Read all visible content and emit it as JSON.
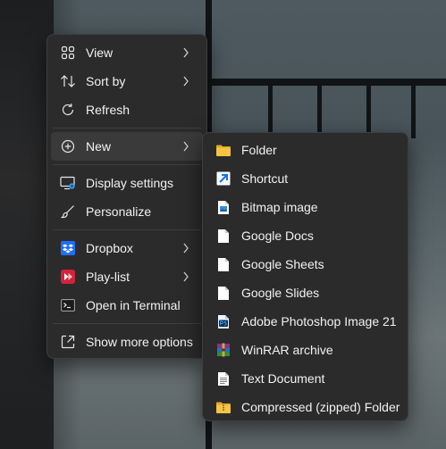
{
  "context_menu": {
    "items": [
      {
        "label": "View",
        "icon": "grid-icon",
        "has_submenu": true
      },
      {
        "label": "Sort by",
        "icon": "sort-icon",
        "has_submenu": true
      },
      {
        "label": "Refresh",
        "icon": "refresh-icon",
        "has_submenu": false
      },
      {
        "label": "New",
        "icon": "plus-circle-icon",
        "has_submenu": true,
        "highlighted": true
      },
      {
        "label": "Display settings",
        "icon": "display-settings-icon",
        "has_submenu": false
      },
      {
        "label": "Personalize",
        "icon": "brush-icon",
        "has_submenu": false
      },
      {
        "label": "Dropbox",
        "icon": "dropbox-icon",
        "has_submenu": true
      },
      {
        "label": "Play-list",
        "icon": "playlist-icon",
        "has_submenu": true
      },
      {
        "label": "Open in Terminal",
        "icon": "terminal-icon",
        "has_submenu": false
      },
      {
        "label": "Show more options",
        "icon": "show-more-icon",
        "has_submenu": false
      }
    ]
  },
  "new_submenu": {
    "items": [
      {
        "label": "Folder",
        "icon": "folder-icon"
      },
      {
        "label": "Shortcut",
        "icon": "shortcut-icon"
      },
      {
        "label": "Bitmap image",
        "icon": "bitmap-file-icon"
      },
      {
        "label": "Google Docs",
        "icon": "file-icon"
      },
      {
        "label": "Google Sheets",
        "icon": "file-icon"
      },
      {
        "label": "Google Slides",
        "icon": "file-icon"
      },
      {
        "label": "Adobe Photoshop Image 21",
        "icon": "photoshop-icon"
      },
      {
        "label": "WinRAR archive",
        "icon": "winrar-icon"
      },
      {
        "label": "Text Document",
        "icon": "text-document-icon"
      },
      {
        "label": "Compressed (zipped) Folder",
        "icon": "zip-folder-icon"
      }
    ]
  },
  "colors": {
    "menu_bg": "#2b2b2b",
    "hover_bg": "#3a3a3a",
    "text": "#f2f2f2",
    "folder_yellow": "#f5c542",
    "shortcut_blue": "#4aa8f0",
    "dropbox_blue": "#1f6fff",
    "playlist_red": "#d2233c"
  }
}
